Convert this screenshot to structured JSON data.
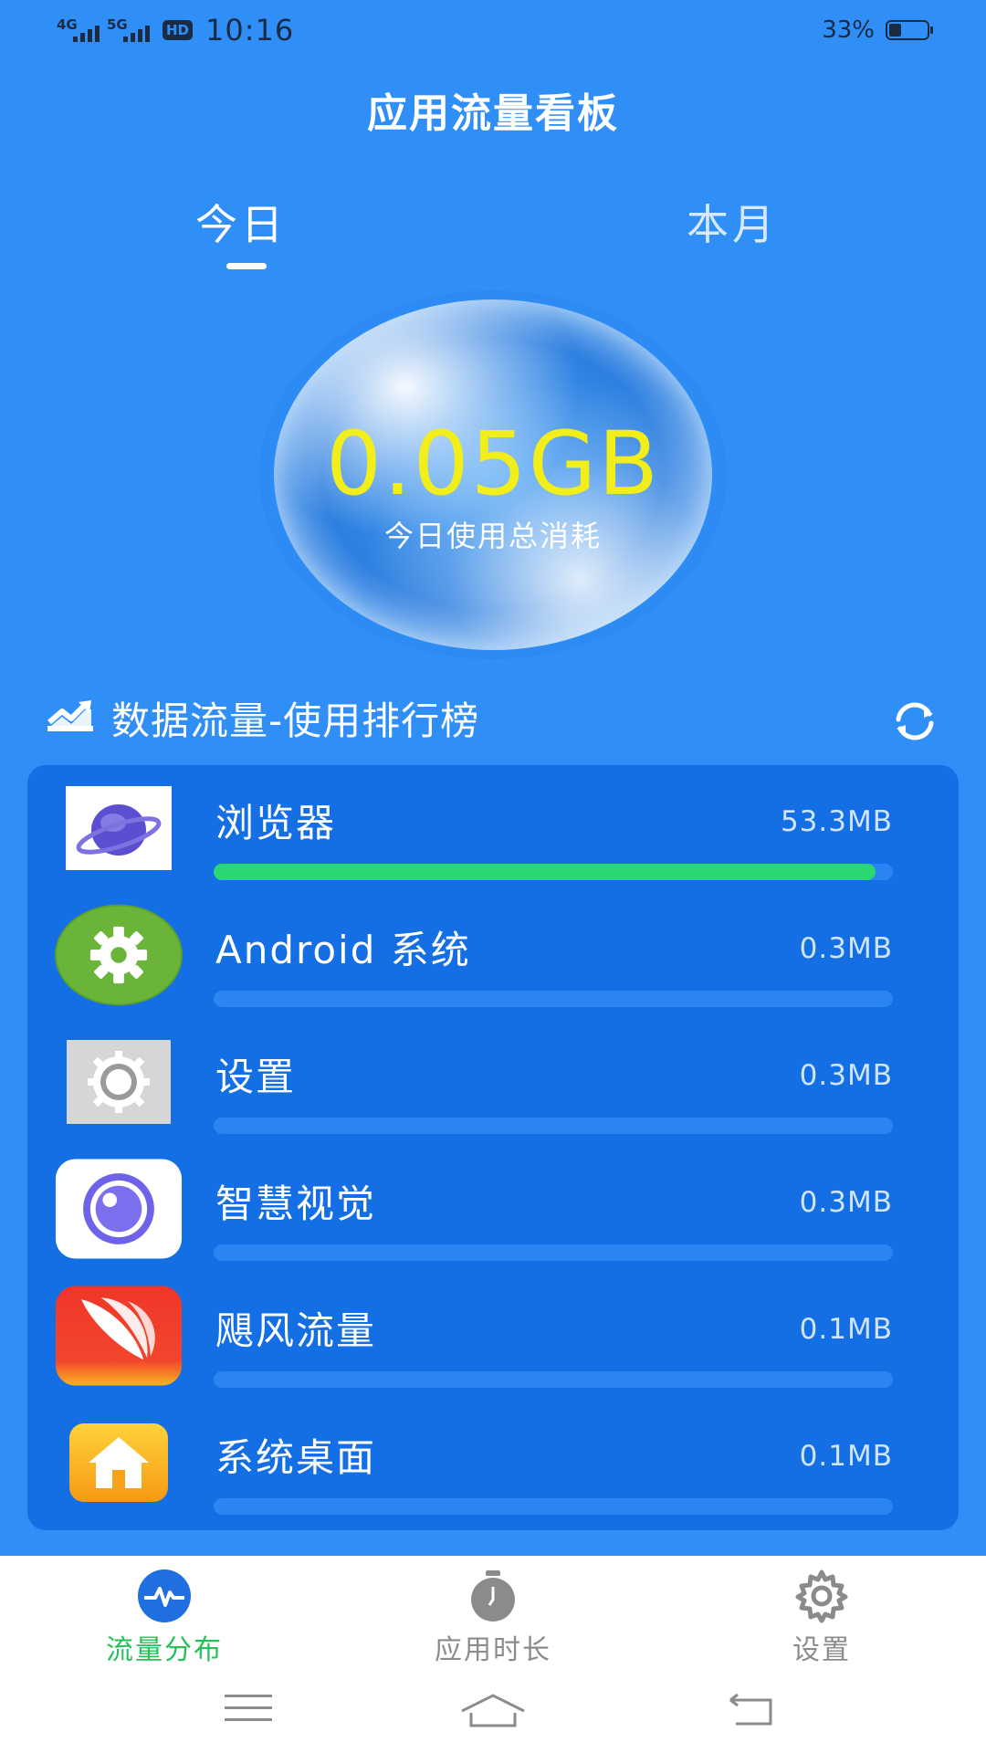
{
  "status_bar": {
    "sim1": "4G",
    "sim2": "5G",
    "hd": "HD",
    "time": "10:16",
    "battery_pct": "33%",
    "battery_level": 0.33
  },
  "header": {
    "title": "应用流量看板",
    "tabs": [
      {
        "label": "今日",
        "active": true
      },
      {
        "label": "本月",
        "active": false
      }
    ]
  },
  "summary": {
    "value": "0.05GB",
    "caption": "今日使用总消耗"
  },
  "ranking": {
    "title": "数据流量-使用排行榜",
    "icons": {
      "header": "trend-chart-icon",
      "refresh": "refresh-icon"
    },
    "apps": [
      {
        "name": "浏览器",
        "size": "53.3MB",
        "fraction": 1.0,
        "icon": "browser-planet-icon"
      },
      {
        "name": "Android  系统",
        "size": "0.3MB",
        "fraction": 0.0,
        "icon": "android-system-gear-icon"
      },
      {
        "name": "设置",
        "size": "0.3MB",
        "fraction": 0.0,
        "icon": "settings-gear-icon"
      },
      {
        "name": "智慧视觉",
        "size": "0.3MB",
        "fraction": 0.0,
        "icon": "smart-vision-eye-icon"
      },
      {
        "name": "飓风流量",
        "size": "0.1MB",
        "fraction": 0.0,
        "icon": "hurricane-traffic-icon"
      },
      {
        "name": "系统桌面",
        "size": "0.1MB",
        "fraction": 0.0,
        "icon": "home-desktop-icon"
      }
    ]
  },
  "bottom_nav": {
    "items": [
      {
        "label": "流量分布",
        "icon": "pulse-icon",
        "active": true
      },
      {
        "label": "应用时长",
        "icon": "stopwatch-icon",
        "active": false
      },
      {
        "label": "设置",
        "icon": "gear-icon",
        "active": false
      }
    ]
  },
  "colors": {
    "background": "#2f8ff7",
    "card": "#136fe3",
    "accent_green": "#2ad770",
    "value_yellow": "#f2ee1a",
    "nav_active": "#26c15a",
    "nav_inactive": "#8b8b8b"
  }
}
